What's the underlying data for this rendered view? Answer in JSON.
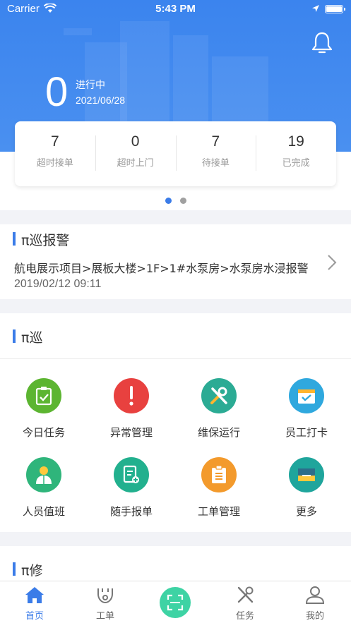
{
  "status_bar": {
    "carrier": "Carrier",
    "time": "5:43 PM"
  },
  "summary": {
    "count": "0",
    "status": "进行中",
    "date": "2021/06/28",
    "stats": [
      {
        "value": "7",
        "label": "超时接单"
      },
      {
        "value": "0",
        "label": "超时上门"
      },
      {
        "value": "7",
        "label": "待接单"
      },
      {
        "value": "19",
        "label": "已完成"
      }
    ]
  },
  "alarm": {
    "title": "π巡报警",
    "text": "航电展示项目>展板大楼>1F>1#水泵房>水泵房水浸报警",
    "date": "2019/02/12 09:11"
  },
  "patrol": {
    "title": "π巡",
    "items": [
      {
        "label": "今日任务",
        "icon": "clipboard-check-icon",
        "color": "#5cb531"
      },
      {
        "label": "异常管理",
        "icon": "exclamation-icon",
        "color": "#e8413f"
      },
      {
        "label": "维保运行",
        "icon": "tools-icon",
        "color": "#2bab94"
      },
      {
        "label": "员工打卡",
        "icon": "calendar-check-icon",
        "color": "#2fa8de"
      },
      {
        "label": "人员值班",
        "icon": "person-icon",
        "color": "#2fb57b"
      },
      {
        "label": "随手报单",
        "icon": "document-add-icon",
        "color": "#22b08e"
      },
      {
        "label": "工单管理",
        "icon": "clipboard-list-icon",
        "color": "#f39a2c"
      },
      {
        "label": "更多",
        "icon": "box-icon",
        "color": "#1fa59c"
      }
    ]
  },
  "repair": {
    "title": "π修"
  },
  "tabbar": {
    "tabs": [
      {
        "label": "首页",
        "icon": "home-icon"
      },
      {
        "label": "工单",
        "icon": "workorder-icon"
      },
      {
        "label": "",
        "icon": "scan-icon"
      },
      {
        "label": "任务",
        "icon": "tools-icon"
      },
      {
        "label": "我的",
        "icon": "user-icon"
      }
    ]
  },
  "colors": {
    "primary": "#3b7ce8",
    "scan": "#3ed3a4"
  }
}
